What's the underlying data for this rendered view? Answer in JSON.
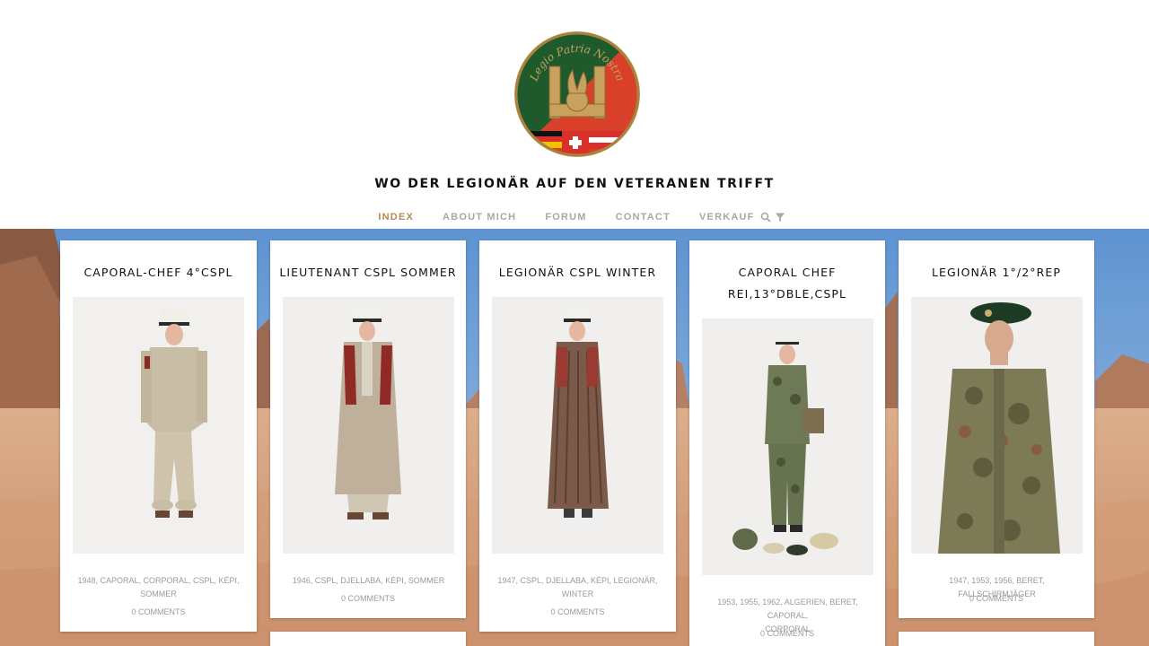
{
  "header": {
    "logo": {
      "name": "legio-patria-nostra-emblem",
      "motto": "Legio Patria Nostra"
    },
    "site_title": "WO DER LEGIONÄR AUF DEN VETERANEN TRIFFT"
  },
  "nav": {
    "items": [
      {
        "label": "INDEX",
        "active": true
      },
      {
        "label": "ABOUT MICH",
        "active": false
      },
      {
        "label": "FORUM",
        "active": false
      },
      {
        "label": "CONTACT",
        "active": false
      },
      {
        "label": "VERKAUF",
        "active": false
      }
    ],
    "search_icon": "search-icon",
    "filter_icon": "filter-icon",
    "active_color": "#b58d4f",
    "inactive_color": "#a8a8a8"
  },
  "cards": [
    {
      "title_lines": [
        "CAPORAL-CHEF 4°CSPL"
      ],
      "tags": [
        "1948",
        "CAPORAL",
        "CORPORAL",
        "CSPL",
        "KÉPI",
        "SOMMER"
      ],
      "tags_line1": "1948, CAPORAL, CORPORAL, CSPL, KÉPI,",
      "tags_line2": "SOMMER",
      "comments": "0 COMMENTS"
    },
    {
      "title_lines": [
        "LIEUTENANT CSPL SOMMER"
      ],
      "tags": [
        "1946",
        "CSPL",
        "DJELLABA",
        "KÉPI",
        "SOMMER"
      ],
      "tags_line1": "1946, CSPL, DJELLABA, KÉPI, SOMMER",
      "tags_line2": "",
      "comments": "0 COMMENTS"
    },
    {
      "title_lines": [
        "LEGIONÄR CSPL WINTER"
      ],
      "tags": [
        "1947",
        "CSPL",
        "DJELLABA",
        "KÉPI",
        "LEGIONÄR",
        "WINTER"
      ],
      "tags_line1": "1947, CSPL, DJELLABA, KÉPI, LEGIONÄR,",
      "tags_line2": "WINTER",
      "comments": "0 COMMENTS"
    },
    {
      "title_lines": [
        "CAPORAL CHEF",
        "REI,13°DBLE,CSPL"
      ],
      "tags": [
        "1953",
        "1955",
        "1962",
        "ALGERIEN",
        "BERET",
        "CAPORAL",
        "CORPORAL"
      ],
      "tags_line1": "1953, 1955, 1962, ALGERIEN, BERET, CAPORAL,",
      "tags_line2": "CORPORAL",
      "comments": "0 COMMENTS"
    },
    {
      "title_lines": [
        "LEGIONÄR 1°/2°REP"
      ],
      "tags": [
        "1947",
        "1953",
        "1956",
        "BERET",
        "FALLSCHIRMJÄGER"
      ],
      "tags_line1": "1947, 1953, 1956, BERET, FALLSCHIRMJÄGER",
      "tags_line2": "",
      "comments": "0 COMMENTS"
    }
  ],
  "colors": {
    "emblem_green": "#1f5a2c",
    "emblem_red": "#d8402a",
    "emblem_gold": "#c9a15e",
    "sky": "#6fa2d8",
    "sand": "#d9a07a"
  }
}
